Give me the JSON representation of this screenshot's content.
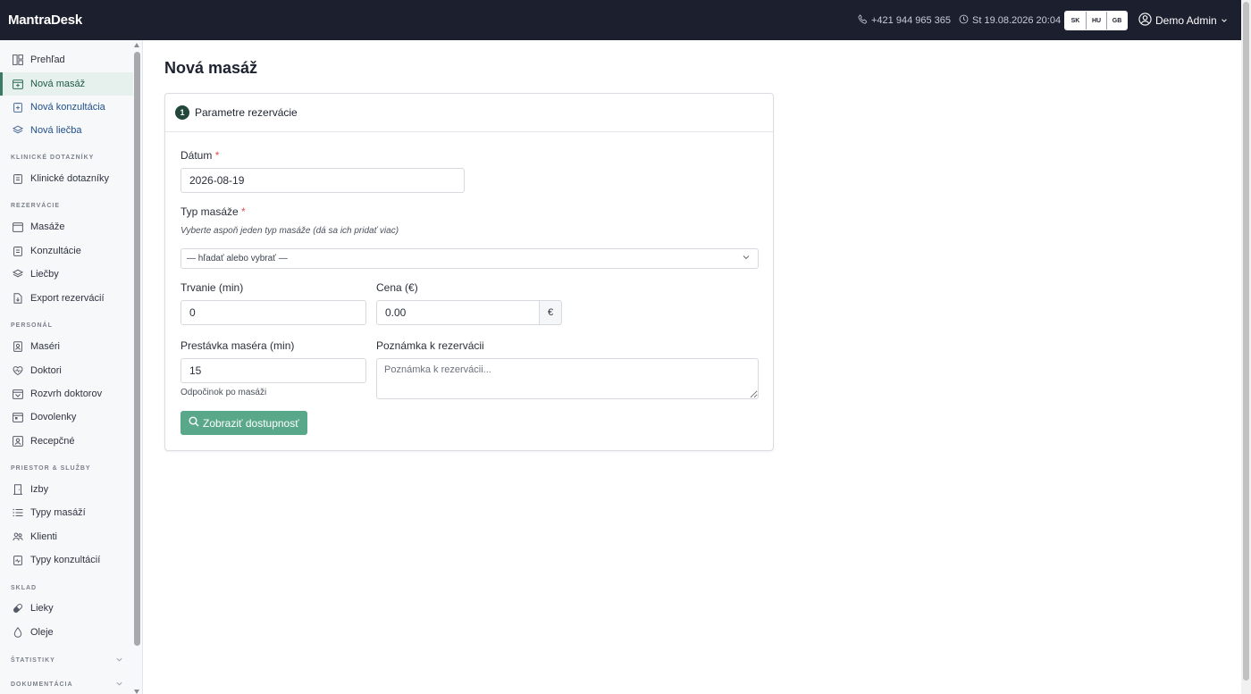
{
  "app": {
    "brand": "MantraDesk"
  },
  "topbar": {
    "phone": "+421 944 965 365",
    "datetime": "St 19.08.2026 20:04",
    "languages": [
      "SK",
      "HU",
      "GB"
    ],
    "active_language": "SK",
    "user": "Demo Admin"
  },
  "sidebar": {
    "top_items": [
      {
        "label": "Prehľad",
        "icon": "dashboard-icon"
      },
      {
        "label": "Nová masáž",
        "icon": "calendar-plus-icon"
      },
      {
        "label": "Nová konzultácia",
        "icon": "clipboard-plus-icon"
      },
      {
        "label": "Nová liečba",
        "icon": "layers-icon"
      }
    ],
    "sections": {
      "clinical": "KLINICKÉ DOTAZNÍKY",
      "reservations": "REZERVÁCIE",
      "staff": "PERSONÁL",
      "space": "PRIESTOR & SLUŽBY",
      "stock": "SKLAD",
      "stats": "ŠTATISTIKY",
      "docs": "DOKUMENTÁCIA"
    },
    "clinical_items": [
      {
        "label": "Klinické dotazníky"
      }
    ],
    "reservation_items": [
      {
        "label": "Masáže"
      },
      {
        "label": "Konzultácie"
      },
      {
        "label": "Liečby"
      },
      {
        "label": "Export rezervácií"
      }
    ],
    "staff_items": [
      {
        "label": "Maséri"
      },
      {
        "label": "Doktori"
      },
      {
        "label": "Rozvrh doktorov"
      },
      {
        "label": "Dovolenky"
      },
      {
        "label": "Recepčné"
      }
    ],
    "space_items": [
      {
        "label": "Izby"
      },
      {
        "label": "Typy masáží"
      },
      {
        "label": "Klienti"
      },
      {
        "label": "Typy konzultácií"
      }
    ],
    "stock_items": [
      {
        "label": "Lieky"
      },
      {
        "label": "Oleje"
      }
    ]
  },
  "main": {
    "title": "Nová masáž",
    "card": {
      "step_number": "1",
      "step_title": "Parametre rezervácie",
      "date_label": "Dátum",
      "date_value": "2026-08-19",
      "type_label": "Typ masáže",
      "type_hint": "Vyberte aspoň jeden typ masáže (dá sa ich pridať viac)",
      "type_placeholder": "— hľadať alebo vybrať —",
      "duration_label": "Trvanie (min)",
      "duration_value": "0",
      "price_label": "Cena (€)",
      "price_value": "0.00",
      "price_unit": "€",
      "break_label": "Prestávka maséra (min)",
      "break_value": "15",
      "break_help": "Odpočinok po masáži",
      "note_label": "Poznámka k rezervácii",
      "note_placeholder": "Poznámka k rezervácii...",
      "submit_label": "Zobraziť dostupnosť"
    }
  },
  "colors": {
    "topbar": "#1c1f2e",
    "accent": "#5aa88a",
    "active_nav": "#e6f0ec"
  }
}
